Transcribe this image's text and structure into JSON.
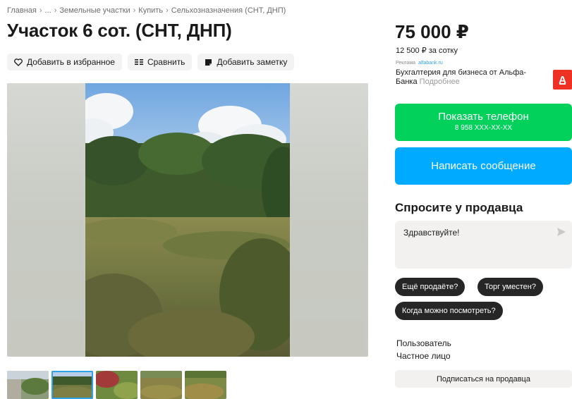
{
  "breadcrumb": {
    "items": [
      "Главная",
      "...",
      "Земельные участки",
      "Купить",
      "Сельхозназначения (СНТ, ДНП)"
    ],
    "separator": "›"
  },
  "title": "Участок 6 сот. (СНТ, ДНП)",
  "actions": {
    "favorite": "Добавить в избранное",
    "compare": "Сравнить",
    "note": "Добавить заметку"
  },
  "price": {
    "main": "75 000 ₽",
    "per_unit": "12 500 ₽ за сотку"
  },
  "ad": {
    "label": "Реклама",
    "domain": "alfabank.ru",
    "text": "Бухгалтерия для бизнеса от Альфа-Банка",
    "more": "Подробнее",
    "logo_letter": "А",
    "logo_color": "#ef3124"
  },
  "contact": {
    "phone_label": "Показать телефон",
    "phone_number": "8 958 XXX-XX-XX",
    "message_label": "Написать сообщение",
    "phone_color": "#02d15c",
    "message_color": "#00aaff"
  },
  "ask": {
    "title": "Спросите у продавца",
    "input_value": "Здравствуйте!",
    "chips": [
      "Ещё продаёте?",
      "Торг уместен?",
      "Когда можно посмотреть?"
    ]
  },
  "seller": {
    "name": "Пользователь",
    "type": "Частное лицо",
    "subscribe": "Подписаться на продавца"
  },
  "gallery": {
    "thumbnail_count": 5,
    "active_thumbnail": 2
  }
}
